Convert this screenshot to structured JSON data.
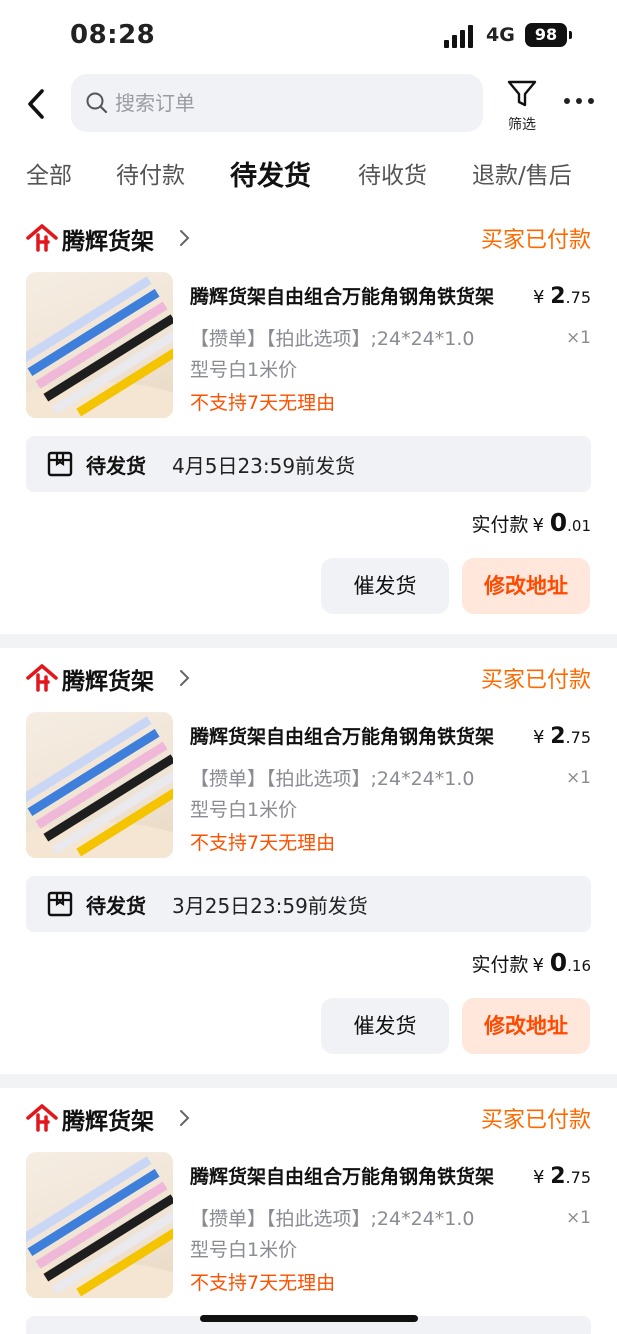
{
  "status_bar": {
    "time": "08:28",
    "network": "4G",
    "battery": "98"
  },
  "header": {
    "search_placeholder": "搜索订单",
    "filter_label": "筛选"
  },
  "tabs": [
    {
      "label": "全部"
    },
    {
      "label": "待付款"
    },
    {
      "label": "待发货",
      "active": true
    },
    {
      "label": "待收货"
    },
    {
      "label": "退款/售后"
    }
  ],
  "orders": [
    {
      "shop": "腾辉货架",
      "status": "买家已付款",
      "title": "腾辉货架自由组合万能角钢角铁货架",
      "price_symbol": "¥",
      "price_int": "2",
      "price_dec": ".75",
      "spec1": "【攒单】【拍此选项】;24*24*1.0",
      "spec2": "型号白1米价",
      "qty": "×1",
      "policy": "不支持7天无理由",
      "ship_label": "待发货",
      "ship_deadline": "4月5日23:59前发货",
      "paid_label": "实付款",
      "paid_symbol": "¥",
      "paid_int": "0",
      "paid_dec": ".01",
      "btn_urge": "催发货",
      "btn_address": "修改地址"
    },
    {
      "shop": "腾辉货架",
      "status": "买家已付款",
      "title": "腾辉货架自由组合万能角钢角铁货架",
      "price_symbol": "¥",
      "price_int": "2",
      "price_dec": ".75",
      "spec1": "【攒单】【拍此选项】;24*24*1.0",
      "spec2": "型号白1米价",
      "qty": "×1",
      "policy": "不支持7天无理由",
      "ship_label": "待发货",
      "ship_deadline": "3月25日23:59前发货",
      "paid_label": "实付款",
      "paid_symbol": "¥",
      "paid_int": "0",
      "paid_dec": ".16",
      "btn_urge": "催发货",
      "btn_address": "修改地址"
    },
    {
      "shop": "腾辉货架",
      "status": "买家已付款",
      "title": "腾辉货架自由组合万能角钢角铁货架",
      "price_symbol": "¥",
      "price_int": "2",
      "price_dec": ".75",
      "spec1": "【攒单】【拍此选项】;24*24*1.0",
      "spec2": "型号白1米价",
      "qty": "×1",
      "policy": "不支持7天无理由"
    }
  ],
  "colors": {
    "accent_orange": "#ff6a00",
    "shop_logo_red": "#e3161c",
    "button_address_bg": "#ffe7dc"
  }
}
